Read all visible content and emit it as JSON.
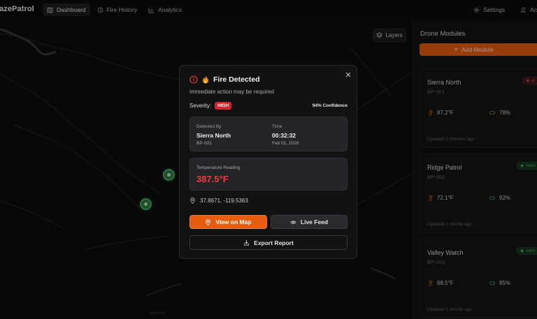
{
  "header": {
    "brand": "azePatrol",
    "nav": [
      {
        "label": "Dashboard",
        "icon": "map-icon",
        "active": true
      },
      {
        "label": "Fire History",
        "icon": "history-icon"
      },
      {
        "label": "Analytics",
        "icon": "chart-icon"
      }
    ],
    "settings_label": "Settings",
    "account_label": "Ac"
  },
  "map": {
    "layers_label": "Layers",
    "place_label": "Shoshone"
  },
  "sidebar": {
    "title": "Drone Modules",
    "add_label": "Add Module",
    "modules": [
      {
        "name": "Sierra North",
        "id": "BP-001",
        "status": "al",
        "temp": "87.2°F",
        "battery": "78%",
        "updated": "Updated 2 minutes ago"
      },
      {
        "name": "Ridge Patrol",
        "id": "BP-002",
        "status": "norm",
        "temp": "72.1°F",
        "battery": "92%",
        "updated": "Updated 1 minute ago"
      },
      {
        "name": "Valley Watch",
        "id": "BP-003",
        "status": "norm",
        "temp": "68.5°F",
        "battery": "85%",
        "updated": "Updated 1 minute ago"
      }
    ]
  },
  "modal": {
    "title": "Fire Detected",
    "subtitle": "Immediate action may be required",
    "severity_label": "Severity:",
    "severity": "HIGH",
    "confidence": "94% Confidence",
    "detected_by_label": "Detected By",
    "detected_by": "Sierra North",
    "detected_by_id": "BP-001",
    "time_label": "Time",
    "time": "00:32:32",
    "date": "Feb 01, 2026",
    "temp_label": "Temperature Reading",
    "temp": "387.5°F",
    "coords": "37.8671, -119.5363",
    "view_map": "View on Map",
    "live_feed": "Live Feed",
    "export": "Export Report"
  },
  "colors": {
    "accent": "#e85c10",
    "danger": "#ef3b3b",
    "ok": "#4fb86d"
  }
}
